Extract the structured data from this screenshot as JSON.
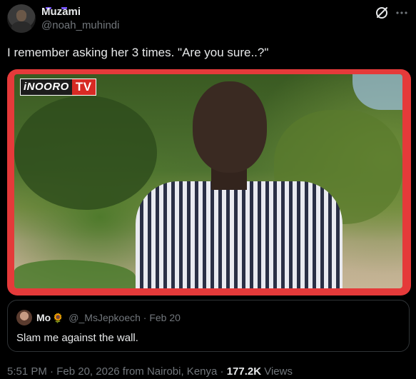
{
  "author": {
    "display_name": "Muzami",
    "handle": "@noah_muhindi"
  },
  "tweet": {
    "text": "I remember asking her 3 times. \"Are you sure..?\""
  },
  "media": {
    "logo_part1": "iNOORO",
    "logo_part2": "TV",
    "border_color": "#e53a3a"
  },
  "quote": {
    "name": "Mo",
    "emoji": "🌻",
    "handle": "@_MsJepkoech",
    "separator": "·",
    "date": "Feb 20",
    "text": "Slam me against the wall."
  },
  "meta": {
    "time": "5:51 PM",
    "separator1": "·",
    "date": "Feb 20, 2026 from Nairobi, Kenya",
    "separator2": "·",
    "views_count": "177.2K",
    "views_label": "Views"
  },
  "icons": {
    "grok": "grok-icon",
    "more": "more-icon"
  },
  "colors": {
    "background": "#000000",
    "primary_text": "#e7e9ea",
    "secondary_text": "#71767b",
    "border": "#2f3336"
  }
}
